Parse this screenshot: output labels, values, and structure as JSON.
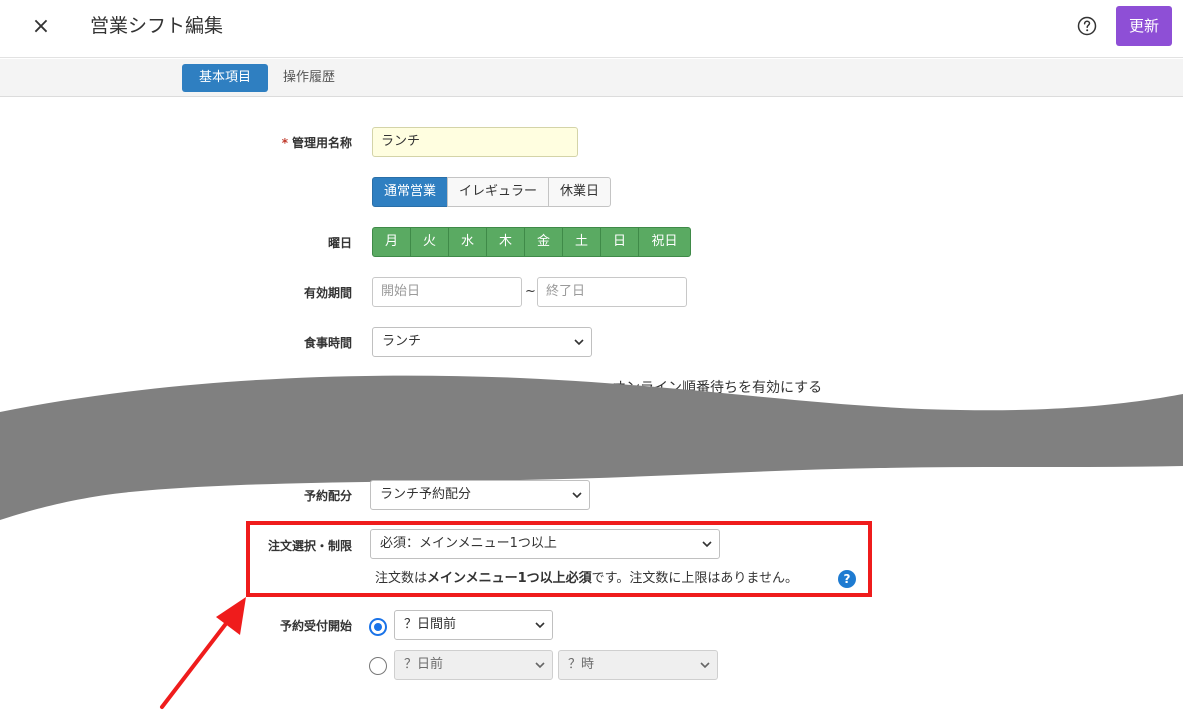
{
  "header": {
    "close_glyph": "×",
    "title": "営業シフト編集",
    "help_icon": "question-circle-icon",
    "update_label": "更新"
  },
  "tabs": {
    "active": "基本項目",
    "other": "操作履歴"
  },
  "form": {
    "name": {
      "required_mark": "*",
      "label": "管理用名称",
      "value": "ランチ"
    },
    "type_segments": [
      "通常営業",
      "イレギュラー",
      "休業日"
    ],
    "weekday": {
      "label": "曜日",
      "days": [
        "月",
        "火",
        "水",
        "木",
        "金",
        "土",
        "日",
        "祝日"
      ]
    },
    "period": {
      "label": "有効期間",
      "start_placeholder": "開始日",
      "separator": "~",
      "end_placeholder": "終了日"
    },
    "meal": {
      "label": "食事時間",
      "value": "ランチ"
    },
    "online_queue": {
      "label": "オンライン順番待ちを有効にする"
    },
    "reservation_alloc": {
      "label": "予約配分",
      "value": "ランチ予約配分"
    },
    "order_select": {
      "label": "注文選択・制限",
      "value": "必須：メインメニュー1つ以上",
      "note_prefix": "注文数は",
      "note_bold": "メインメニュー1つ以上必須",
      "note_suffix": "です。注文数に上限はありません。",
      "help_glyph": "?"
    },
    "reserve_start": {
      "label": "予約受付開始",
      "days_before": "？日間前",
      "day_before_disabled": "？日前",
      "hour_disabled": "？時"
    }
  },
  "colors": {
    "accent_purple": "#8e4fd6",
    "tab_blue": "#2f7fc1",
    "day_green": "#5aaa62",
    "highlight_red": "#ef1c1c",
    "wave_gray": "#808080"
  }
}
